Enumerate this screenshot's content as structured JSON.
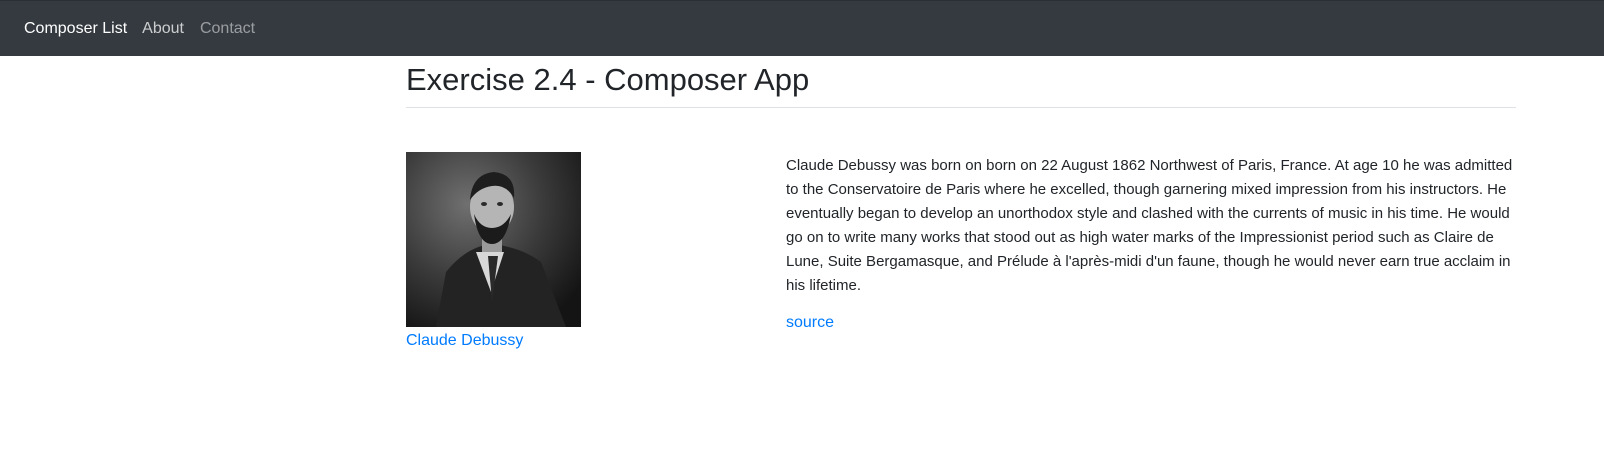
{
  "nav": {
    "brand": "Composer List",
    "links": [
      "About",
      "Contact"
    ]
  },
  "page": {
    "title": "Exercise 2.4 - Composer App"
  },
  "composer": {
    "name": "Claude Debussy",
    "bio": "Claude Debussy was born on born on 22 August 1862 Northwest of Paris, France. At age 10 he was admitted to the Conservatoire de Paris where he excelled, though garnering mixed impression from his instructors. He eventually began to develop an unorthodox style and clashed with the currents of music in his time. He would go on to write many works that stood out as high water marks of the Impressionist period such as Claire de Lune, Suite Bergamasque, and Prélude à l'après-midi d'un faune, though he would never earn true acclaim in his lifetime.",
    "source_label": "source"
  },
  "colors": {
    "navbar": "#343a40",
    "link": "#007bff",
    "text": "#212529"
  }
}
